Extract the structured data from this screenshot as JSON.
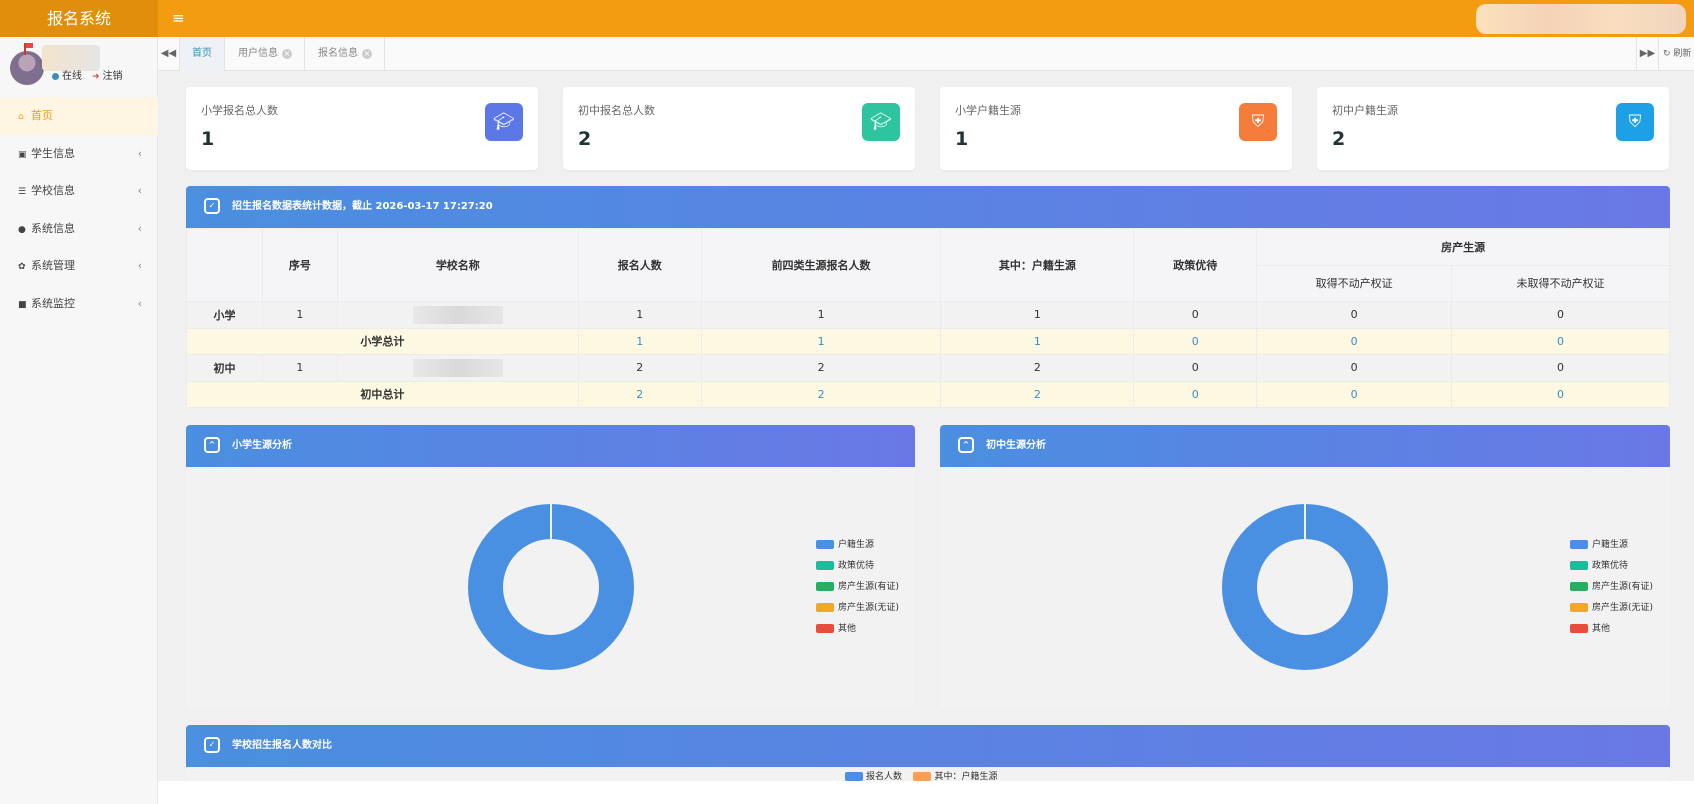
{
  "app": {
    "title": "报名系统"
  },
  "header": {
    "menu_icon": "≡"
  },
  "user": {
    "status": "在线",
    "logout": "注销"
  },
  "sidebar": {
    "items": [
      {
        "label": "首页",
        "icon": "home-icon",
        "active": true
      },
      {
        "label": "学生信息",
        "icon": "book-icon"
      },
      {
        "label": "学校信息",
        "icon": "list-icon"
      },
      {
        "label": "系统信息",
        "icon": "circle-icon"
      },
      {
        "label": "系统管理",
        "icon": "gear-icon"
      },
      {
        "label": "系统监控",
        "icon": "video-icon"
      }
    ]
  },
  "tabs": [
    {
      "label": "首页",
      "active": true
    },
    {
      "label": "用户信息"
    },
    {
      "label": "报名信息"
    }
  ],
  "tabs_right": {
    "refresh_label": "刷新"
  },
  "cards": [
    {
      "label": "小学报名总人数",
      "value": "1",
      "color": "#5b78e6",
      "icon": "graduation-cap-icon"
    },
    {
      "label": "初中报名总人数",
      "value": "2",
      "color": "#2ec4a0",
      "icon": "graduation-cap-icon"
    },
    {
      "label": "小学户籍生源",
      "value": "1",
      "color": "#f57c3a",
      "icon": "shield-icon"
    },
    {
      "label": "初中户籍生源",
      "value": "2",
      "color": "#1ea0e6",
      "icon": "shield-icon"
    }
  ],
  "stats_panel": {
    "title": "招生报名数据表统计数据，截止 2026-03-17 17:27:20",
    "headers": {
      "seq": "序号",
      "school": "学校名称",
      "enrolled": "报名人数",
      "top4": "前四类生源报名人数",
      "hukou": "其中：户籍生源",
      "policy": "政策优待",
      "property": "房产生源",
      "with_cert": "取得不动产权证",
      "without_cert": "未取得不动产权证"
    },
    "rows": [
      {
        "level": "小学",
        "seq": "1",
        "enrolled": "1",
        "top4": "1",
        "hukou": "1",
        "policy": "0",
        "with_cert": "0",
        "without_cert": "0"
      },
      {
        "total_label": "小学总计",
        "enrolled": "1",
        "top4": "1",
        "hukou": "1",
        "policy": "0",
        "with_cert": "0",
        "without_cert": "0"
      },
      {
        "level": "初中",
        "seq": "1",
        "enrolled": "2",
        "top4": "2",
        "hukou": "2",
        "policy": "0",
        "with_cert": "0",
        "without_cert": "0"
      },
      {
        "total_label": "初中总计",
        "enrolled": "2",
        "top4": "2",
        "hukou": "2",
        "policy": "0",
        "with_cert": "0",
        "without_cert": "0"
      }
    ]
  },
  "legend_items": [
    {
      "label": "户籍生源",
      "color": "#4a90e2"
    },
    {
      "label": "政策优待",
      "color": "#1abc9c"
    },
    {
      "label": "房产生源(有证)",
      "color": "#27ae60"
    },
    {
      "label": "房产生源(无证)",
      "color": "#f5a623"
    },
    {
      "label": "其他",
      "color": "#e74c3c"
    }
  ],
  "chart_data": [
    {
      "type": "pie",
      "title": "小学生源分析",
      "categories": [
        "户籍生源",
        "政策优待",
        "房产生源(有证)",
        "房产生源(无证)",
        "其他"
      ],
      "values": [
        1,
        0,
        0,
        0,
        0
      ],
      "colors": [
        "#4a90e2",
        "#1abc9c",
        "#27ae60",
        "#f5a623",
        "#e74c3c"
      ],
      "donut": true,
      "legend": "right"
    },
    {
      "type": "pie",
      "title": "初中生源分析",
      "categories": [
        "户籍生源",
        "政策优待",
        "房产生源(有证)",
        "房产生源(无证)",
        "其他"
      ],
      "values": [
        2,
        0,
        0,
        0,
        0
      ],
      "colors": [
        "#4a90e2",
        "#1abc9c",
        "#27ae60",
        "#f5a623",
        "#e74c3c"
      ],
      "donut": true,
      "legend": "right"
    },
    {
      "type": "bar",
      "title": "学校招生报名人数对比",
      "series": [
        {
          "name": "报名人数",
          "color": "#4a90e2"
        },
        {
          "name": "其中：户籍生源",
          "color": "#f5a05a"
        }
      ],
      "legend": "top"
    }
  ]
}
